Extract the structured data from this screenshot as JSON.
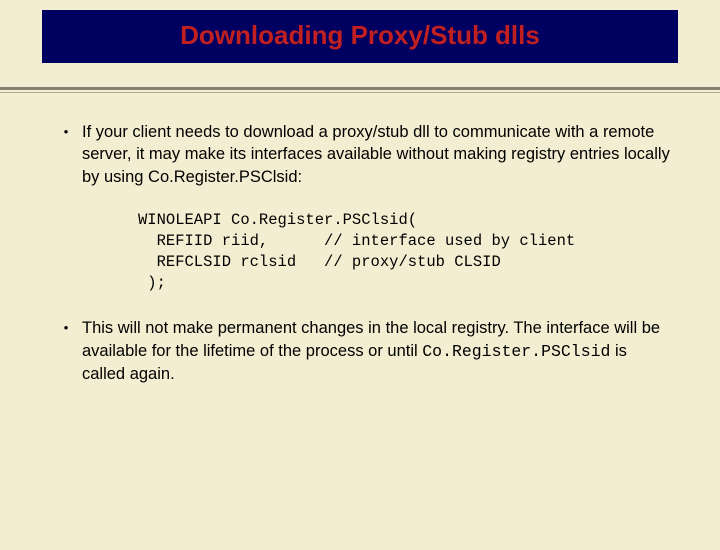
{
  "title": "Downloading Proxy/Stub dlls",
  "bullets": {
    "item1": {
      "text": "If your client needs to download a proxy/stub dll to communicate with a remote server, it may make its interfaces available without making registry entries locally by using Co.Register.PSClsid:"
    },
    "item2": {
      "prefix": "This will not make permanent changes in the local registry.  The interface will be available for the lifetime of the process or until ",
      "code": "Co.Register.PSClsid",
      "suffix": " is called again."
    }
  },
  "code": "WINOLEAPI Co.Register.PSClsid(\n  REFIID riid,      // interface used by client\n  REFCLSID rclsid   // proxy/stub CLSID\n );"
}
